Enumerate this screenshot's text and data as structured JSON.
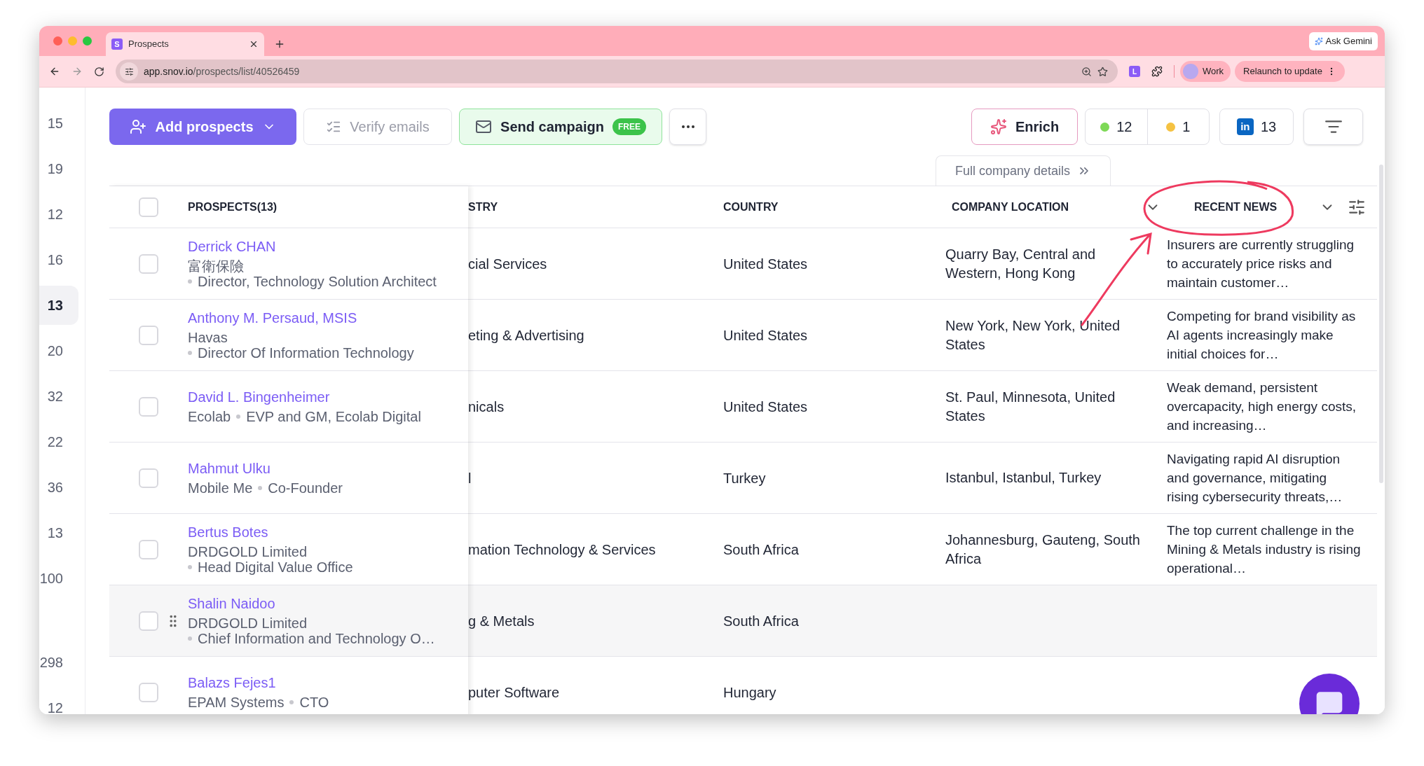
{
  "browser": {
    "tab_title": "Prospects",
    "favicon": "S",
    "url_host": "app.snov.io",
    "url_path": "/prospects/list/40526459",
    "gemini": "Ask Gemini",
    "extension": "L",
    "profile": "Work",
    "relaunch": "Relaunch to update"
  },
  "side_numbers": [
    {
      "label": "15",
      "selected": false
    },
    {
      "label": "19",
      "selected": false
    },
    {
      "label": "12",
      "selected": false
    },
    {
      "label": "16",
      "selected": false
    },
    {
      "label": "13",
      "selected": true
    },
    {
      "label": "20",
      "selected": false
    },
    {
      "label": "32",
      "selected": false
    },
    {
      "label": "22",
      "selected": false
    },
    {
      "label": "36",
      "selected": false
    },
    {
      "label": "13",
      "selected": false
    },
    {
      "label": "100",
      "selected": false
    },
    {
      "label": "298",
      "selected": false
    },
    {
      "label": "12",
      "selected": false
    }
  ],
  "toolbar": {
    "add": "Add prospects",
    "verify": "Verify emails",
    "send": "Send campaign",
    "free": "FREE",
    "enrich": "Enrich",
    "counts": [
      {
        "label": "12",
        "color": "#7ed957"
      },
      {
        "label": "1",
        "color": "#f5c242"
      }
    ],
    "linkedin_logo": "in",
    "linkedin_count": "13"
  },
  "company_details": "Full company details",
  "table": {
    "all_checked": false,
    "columns": [
      "PROSPECTS(13)",
      "STRY",
      "COUNTRY",
      "COMPANY LOCATION",
      "RECENT NEWS"
    ],
    "rows": [
      {
        "name": "Derrick CHAN",
        "company": "富衛保險",
        "title": "Director, Technology Solution Architect",
        "industry": "cial Services",
        "country": "United States",
        "location": "Quarry Bay, Central and Western, Hong Kong",
        "news": "Insurers are currently struggling to accurately price risks and maintain customer…",
        "checked": false,
        "hovered": false
      },
      {
        "name": "Anthony M. Persaud, MSIS",
        "company": "Havas",
        "title": "Director Of Information Technology",
        "industry": "eting & Advertising",
        "country": "United States",
        "location": "New York, New York, United States",
        "news": "Competing for brand visibility as AI agents increasingly make initial choices for…",
        "checked": false,
        "hovered": false
      },
      {
        "name": "David L. Bingenheimer",
        "company": "Ecolab",
        "title": "EVP and GM, Ecolab Digital",
        "industry": "nicals",
        "country": "United States",
        "location": "St. Paul, Minnesota, United States",
        "news": "Weak demand, persistent overcapacity, high energy costs, and increasing…",
        "checked": false,
        "hovered": false
      },
      {
        "name": "Mahmut Ulku",
        "company": "Mobile Me",
        "title": "Co-Founder",
        "industry": "l",
        "country": "Turkey",
        "location": "Istanbul, Istanbul, Turkey",
        "news": "Navigating rapid AI disruption and governance, mitigating rising cybersecurity threats,…",
        "checked": false,
        "hovered": false
      },
      {
        "name": "Bertus Botes",
        "company": "DRDGOLD Limited",
        "title": "Head Digital Value Office",
        "industry": "mation Technology & Services",
        "country": "South Africa",
        "location": "Johannesburg, Gauteng, South Africa",
        "news": "The top current challenge in the Mining & Metals industry is rising operational…",
        "checked": false,
        "hovered": false
      },
      {
        "name": "Shalin Naidoo",
        "company": "DRDGOLD Limited",
        "title": "Chief Information and Technology O…",
        "industry": "g & Metals",
        "country": "South Africa",
        "checked": false,
        "hovered": true
      },
      {
        "name": "Balazs Fejes1",
        "company": "EPAM Systems",
        "title": "CTO",
        "industry": "puter Software",
        "country": "Hungary",
        "checked": false,
        "hovered": false
      }
    ]
  }
}
